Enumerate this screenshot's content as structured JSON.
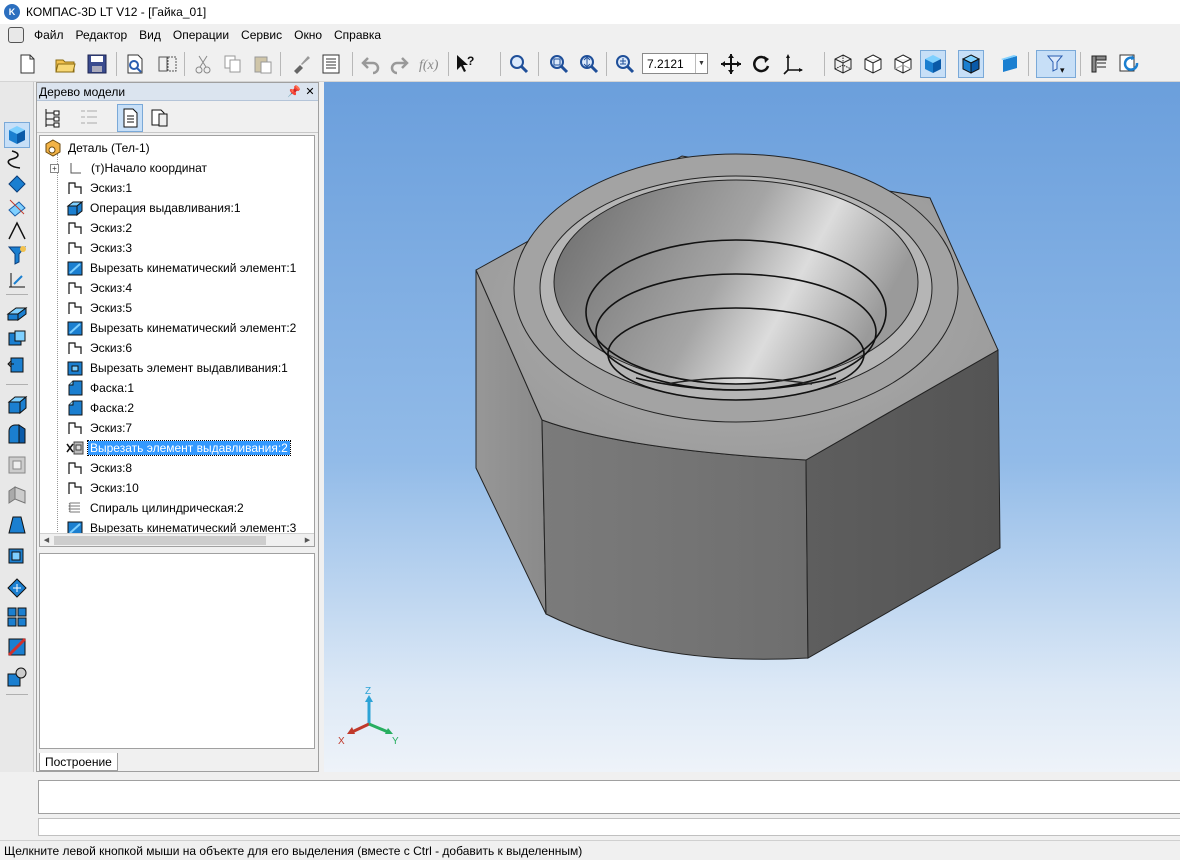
{
  "app": {
    "title": "КОМПАС-3D LT V12 - [Гайка_01]",
    "logo": "K"
  },
  "menu": [
    "Файл",
    "Редактор",
    "Вид",
    "Операции",
    "Сервис",
    "Окно",
    "Справка"
  ],
  "toolbar": {
    "zoom_value": "7.2121",
    "icons": [
      "new-document",
      "open-folder",
      "save",
      "preview",
      "align",
      "cut",
      "copy",
      "paste",
      "brush",
      "properties",
      "undo",
      "redo",
      "fx-function",
      "help-pointer",
      "zoom-window",
      "zoom-in-out",
      "zoom-scale",
      "zoom-fit",
      "pan",
      "rotate",
      "orient-axes",
      "wireframe",
      "hidden-lines",
      "thin-hidden",
      "shaded",
      "shaded-edges",
      "perspective",
      "filter",
      "triad",
      "rebuild"
    ]
  },
  "tree": {
    "header_title": "Дерево модели",
    "root": "Деталь (Тел-1)",
    "items": [
      {
        "label": "(т)Начало координат",
        "icon": "origin"
      },
      {
        "label": "Эскиз:1",
        "icon": "sketch"
      },
      {
        "label": "Операция выдавливания:1",
        "icon": "extrude"
      },
      {
        "label": "Эскиз:2",
        "icon": "sketch"
      },
      {
        "label": "Эскиз:3",
        "icon": "sketch"
      },
      {
        "label": "Вырезать кинематический элемент:1",
        "icon": "sweep-cut"
      },
      {
        "label": "Эскиз:4",
        "icon": "sketch"
      },
      {
        "label": "Эскиз:5",
        "icon": "sketch"
      },
      {
        "label": "Вырезать кинематический элемент:2",
        "icon": "sweep-cut"
      },
      {
        "label": "Эскиз:6",
        "icon": "sketch"
      },
      {
        "label": "Вырезать элемент выдавливания:1",
        "icon": "extrude-cut"
      },
      {
        "label": "Фаска:1",
        "icon": "chamfer"
      },
      {
        "label": "Фаска:2",
        "icon": "chamfer"
      },
      {
        "label": "Эскиз:7",
        "icon": "sketch"
      },
      {
        "label": "Вырезать элемент выдавливания:2",
        "icon": "extrude-cut-disabled",
        "selected": true
      },
      {
        "label": "Эскиз:8",
        "icon": "sketch"
      },
      {
        "label": "Эскиз:10",
        "icon": "sketch"
      },
      {
        "label": "Спираль цилиндрическая:2",
        "icon": "helix"
      },
      {
        "label": "Вырезать кинематический элемент:3",
        "icon": "sweep-cut"
      }
    ],
    "tab_label": "Построение"
  },
  "axes": {
    "x": "X",
    "y": "Y",
    "z": "Z"
  },
  "status": {
    "message": "Щелкните левой кнопкой мыши на объекте для его выделения (вместе с Ctrl - добавить к выделенным)"
  },
  "colors": {
    "accent_blue": "#3399ff",
    "viewport_top": "#6b9fdc",
    "viewport_bottom": "#eef3f9"
  }
}
